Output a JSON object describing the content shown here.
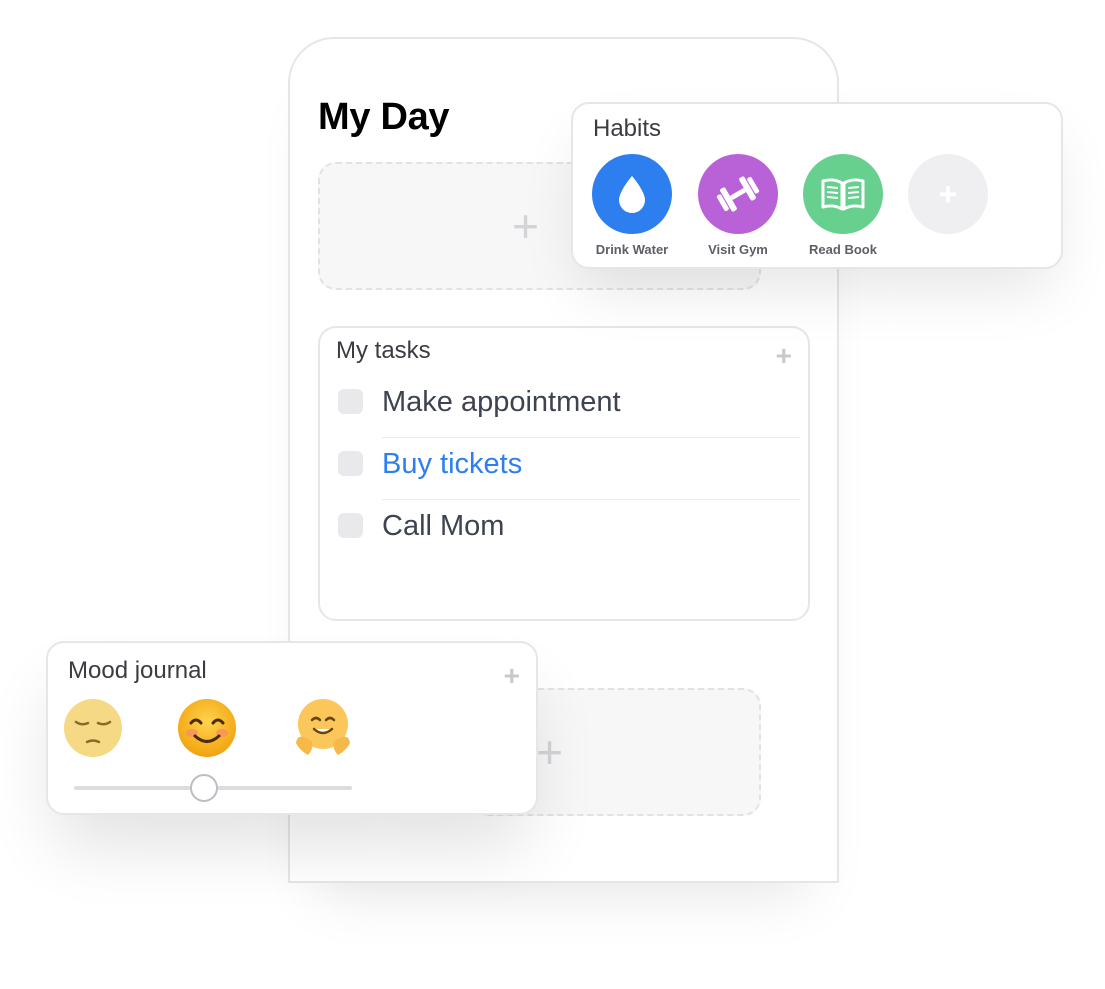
{
  "page": {
    "title": "My Day"
  },
  "tasks": {
    "title": "My tasks",
    "items": [
      {
        "label": "Make appointment",
        "checked": false,
        "highlighted": false
      },
      {
        "label": "Buy tickets",
        "checked": false,
        "highlighted": true
      },
      {
        "label": "Call Mom",
        "checked": false,
        "highlighted": false
      }
    ],
    "highlight_color": "#2d7ff0"
  },
  "habits": {
    "title": "Habits",
    "items": [
      {
        "label": "Drink Water",
        "icon": "water-drop-icon",
        "color": "#2d7ff0"
      },
      {
        "label": "Visit Gym",
        "icon": "dumbbell-icon",
        "color": "#b962d8"
      },
      {
        "label": "Read Book",
        "icon": "book-icon",
        "color": "#67d08e"
      }
    ],
    "add_icon": "plus-icon"
  },
  "mood_journal": {
    "title": "Mood journal",
    "emojis": [
      "pensive-face-emoji",
      "smiling-face-emoji",
      "hugging-face-emoji"
    ],
    "slider_value": 0.47
  }
}
